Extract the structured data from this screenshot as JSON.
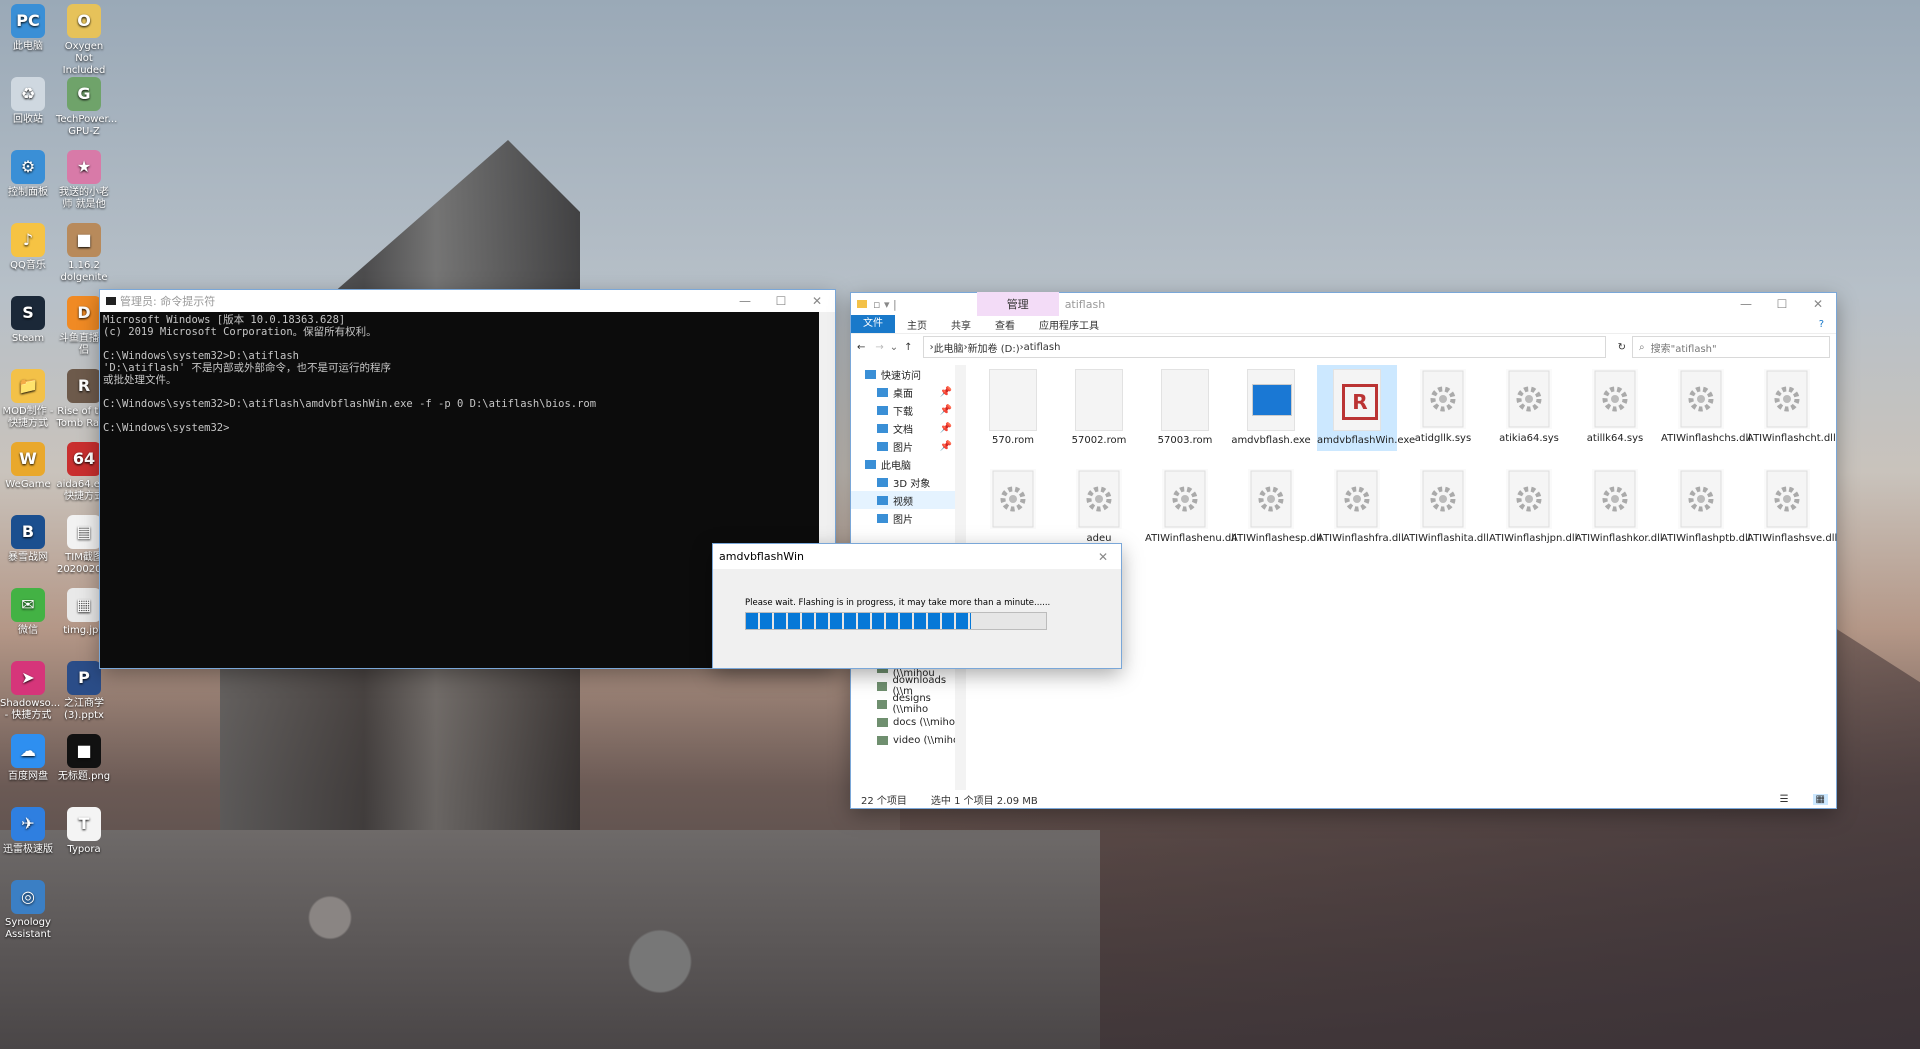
{
  "desktop": {
    "icons": [
      {
        "label": "此电脑",
        "color": "#3a8fd6",
        "glyph": "PC"
      },
      {
        "label": "Oxygen Not Included",
        "color": "#e6c25a",
        "glyph": "O"
      },
      {
        "label": "回收站",
        "color": "#cfd8e0",
        "glyph": "♻"
      },
      {
        "label": "TechPower... GPU-Z",
        "color": "#6fa36a",
        "glyph": "G"
      },
      {
        "label": "控制面板",
        "color": "#3a8fd6",
        "glyph": "⚙"
      },
      {
        "label": "我送的小老师 就是他",
        "color": "#d87aa8",
        "glyph": "★"
      },
      {
        "label": "QQ音乐",
        "color": "#f6c343",
        "glyph": "♪"
      },
      {
        "label": "1.16.2 dolgenite",
        "color": "#b88a5b",
        "glyph": "■"
      },
      {
        "label": "Steam",
        "color": "#1b2838",
        "glyph": "S"
      },
      {
        "label": "斗鱼直播伴侣",
        "color": "#f08a24",
        "glyph": "D"
      },
      {
        "label": "MOD制作 - 快捷方式",
        "color": "#f3c148",
        "glyph": "📁"
      },
      {
        "label": "Rise of the Tomb Rai...",
        "color": "#6d5a4b",
        "glyph": "R"
      },
      {
        "label": "WeGame",
        "color": "#e9a82c",
        "glyph": "W"
      },
      {
        "label": "aida64.exe 快捷方式",
        "color": "#c92f2f",
        "glyph": "64"
      },
      {
        "label": "暴雪战网",
        "color": "#1b4f8f",
        "glyph": "B"
      },
      {
        "label": "TIM截图 2020020...",
        "color": "#f2f2f2",
        "glyph": "▤"
      },
      {
        "label": "微信",
        "color": "#43b244",
        "glyph": "✉"
      },
      {
        "label": "timg.jpg",
        "color": "#e9e9e9",
        "glyph": "▦"
      },
      {
        "label": "Shadowso... - 快捷方式",
        "color": "#d6357a",
        "glyph": "➤"
      },
      {
        "label": "之江商学 (3).pptx",
        "color": "#2b4d88",
        "glyph": "P"
      },
      {
        "label": "百度网盘",
        "color": "#2e8ff0",
        "glyph": "☁"
      },
      {
        "label": "无标题.png",
        "color": "#111111",
        "glyph": "■"
      },
      {
        "label": "迅雷极速版",
        "color": "#2f7fe0",
        "glyph": "✈"
      },
      {
        "label": "Typora",
        "color": "#f4f4f4",
        "glyph": "T"
      },
      {
        "label": "Synology Assistant",
        "color": "#3b7fc4",
        "glyph": "◎"
      }
    ]
  },
  "cmd": {
    "title": "管理员: 命令提示符",
    "lines": [
      "Microsoft Windows [版本 10.0.18363.628]",
      "(c) 2019 Microsoft Corporation。保留所有权利。",
      "",
      "C:\\Windows\\system32>D:\\atiflash",
      "'D:\\atiflash' 不是内部或外部命令，也不是可运行的程序",
      "或批处理文件。",
      "",
      "C:\\Windows\\system32>D:\\atiflash\\amdvbflashWin.exe -f -p 0 D:\\atiflash\\bios.rom",
      "",
      "C:\\Windows\\system32>"
    ]
  },
  "explorer": {
    "title": "atiflash",
    "context_tab": "管理",
    "tabs": [
      "文件",
      "主页",
      "共享",
      "查看",
      "应用程序工具"
    ],
    "breadcrumb": [
      "此电脑",
      "新加卷 (D:)",
      "atiflash"
    ],
    "search_placeholder": "搜索\"atiflash\"",
    "nav_items": [
      {
        "label": "快速访问",
        "pinned": false
      },
      {
        "label": "桌面",
        "pinned": true
      },
      {
        "label": "下载",
        "pinned": true
      },
      {
        "label": "文档",
        "pinned": true
      },
      {
        "label": "图片",
        "pinned": true
      },
      {
        "label": "此电脑",
        "pinned": false
      },
      {
        "label": "3D 对象",
        "pinned": false
      },
      {
        "label": "视频",
        "pinned": false
      },
      {
        "label": "图片",
        "pinned": false
      }
    ],
    "nav_items_lower": [
      "backups (\\\\mih",
      "music (\\\\mihou",
      "downloads (\\\\m",
      "designs (\\\\miho",
      "docs (\\\\mihout",
      "video (\\\\mihou"
    ],
    "files_row1": [
      {
        "name": "570.rom",
        "kind": "blank"
      },
      {
        "name": "57002.rom",
        "kind": "blank"
      },
      {
        "name": "57003.rom",
        "kind": "blank"
      },
      {
        "name": "amdvbflash.exe",
        "kind": "app"
      },
      {
        "name": "amdvbflashWin.exe",
        "kind": "amd",
        "selected": true
      },
      {
        "name": "atidgllk.sys",
        "kind": "gear"
      },
      {
        "name": "atikia64.sys",
        "kind": "gear"
      },
      {
        "name": "atillk64.sys",
        "kind": "gear"
      },
      {
        "name": "ATIWinflashchs.dll",
        "kind": "gear"
      },
      {
        "name": "ATIWinflashcht.dll",
        "kind": "gear"
      }
    ],
    "files_row2": [
      {
        "name": "",
        "kind": "gear"
      },
      {
        "name": "adeu",
        "kind": "gear"
      },
      {
        "name": "ATIWinflashenu.dll",
        "kind": "gear"
      },
      {
        "name": "ATIWinflashesp.dll",
        "kind": "gear"
      },
      {
        "name": "ATIWinflashfra.dll",
        "kind": "gear"
      },
      {
        "name": "ATIWinflashita.dll",
        "kind": "gear"
      },
      {
        "name": "ATIWinflashjpn.dll",
        "kind": "gear"
      },
      {
        "name": "ATIWinflashkor.dll",
        "kind": "gear"
      },
      {
        "name": "ATIWinflashptb.dll",
        "kind": "gear"
      },
      {
        "name": "ATIWinflashsve.dll",
        "kind": "gear"
      }
    ],
    "files_row3": [
      {
        "name": "dll",
        "kind": "gear"
      }
    ],
    "status": {
      "count": "22 个项目",
      "selection": "选中 1 个项目  2.09 MB"
    }
  },
  "dialog": {
    "title": "amdvbflashWin",
    "message": "Please wait.  Flashing is in progress, it may take more than a minute......",
    "progress": 0.75
  },
  "colors": {
    "accent": "#0078d7",
    "selection": "#cce8ff"
  }
}
